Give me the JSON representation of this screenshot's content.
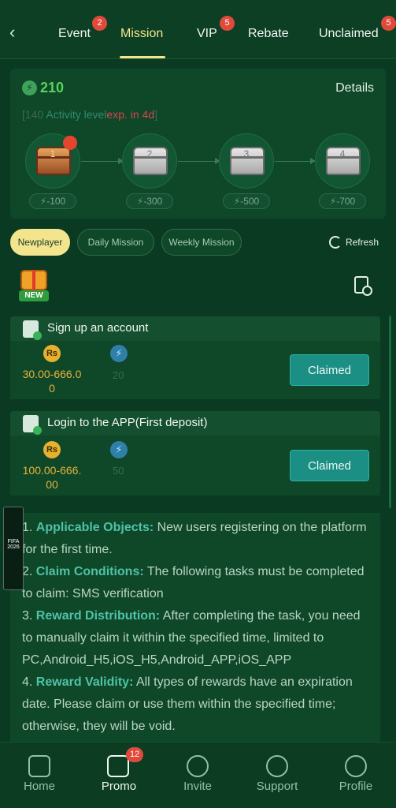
{
  "tabs": [
    {
      "label": "Event",
      "badge": "2"
    },
    {
      "label": "Mission",
      "badge": ""
    },
    {
      "label": "VIP",
      "badge": "5"
    },
    {
      "label": "Rebate",
      "badge": ""
    },
    {
      "label": "Unclaimed",
      "badge": "5"
    }
  ],
  "activity": {
    "points": "210",
    "details_label": "Details",
    "level_prefix": "[140",
    "level_label": "Activity level",
    "expiry": "exp. in 4d",
    "level_suffix": "]"
  },
  "chests": [
    {
      "number": "1",
      "cost": "-100"
    },
    {
      "number": "2",
      "cost": "-300"
    },
    {
      "number": "3",
      "cost": "-500"
    },
    {
      "number": "4",
      "cost": "-700"
    }
  ],
  "mission_tabs": [
    "Newplayer",
    "Daily Mission",
    "Weekly Mission"
  ],
  "refresh_label": "Refresh",
  "new_badge": "NEW",
  "tasks": [
    {
      "title": "Sign up an account",
      "coin_label": "Rs",
      "amount_line1": "30.00-666.0",
      "amount_line2": "0",
      "points": "20",
      "button": "Claimed"
    },
    {
      "title": "Login to the APP(First deposit)",
      "coin_label": "Rs",
      "amount_line1": "100.00-666.",
      "amount_line2": "00",
      "points": "50",
      "button": "Claimed"
    }
  ],
  "rules": [
    {
      "num": "1. ",
      "title": "Applicable Objects:",
      "text": " New users registering on the platform for the first time."
    },
    {
      "num": "2. ",
      "title": "Claim Conditions:",
      "text": " The following tasks must be completed to claim: SMS verification"
    },
    {
      "num": "3. ",
      "title": "Reward Distribution:",
      "text": " After completing the task, you need to manually claim it within the specified time, limited to PC,Android_H5,iOS_H5,Android_APP,iOS_APP"
    },
    {
      "num": "4. ",
      "title": "Reward Validity:",
      "text": " All types of rewards have an expiration date. Please claim or use them within the specified time; otherwise, they will be void."
    }
  ],
  "fifa_label": "FIFA",
  "fifa_year": "2026",
  "nav": [
    {
      "label": "Home",
      "badge": ""
    },
    {
      "label": "Promo",
      "badge": "12"
    },
    {
      "label": "Invite",
      "badge": ""
    },
    {
      "label": "Support",
      "badge": ""
    },
    {
      "label": "Profile",
      "badge": ""
    }
  ],
  "colors": {
    "background": "#0b3a22",
    "accent": "#f3e58d",
    "claimed": "#1c8f85",
    "badge": "#e14a3b"
  }
}
